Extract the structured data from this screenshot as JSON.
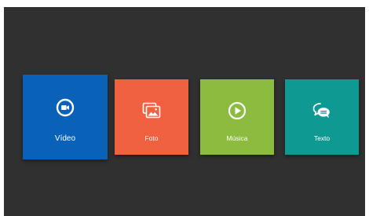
{
  "tiles": [
    {
      "id": "video",
      "label": "Vídeo",
      "icon": "video-camera-icon",
      "color": "#0a62b8",
      "focused": true
    },
    {
      "id": "foto",
      "label": "Foto",
      "icon": "photo-gallery-icon",
      "color": "#f0613f",
      "focused": false
    },
    {
      "id": "musica",
      "label": "Música",
      "icon": "play-icon",
      "color": "#8bbb3f",
      "focused": false
    },
    {
      "id": "texto",
      "label": "Texto",
      "icon": "chat-bubbles-icon",
      "color": "#0e9a92",
      "focused": false
    }
  ],
  "colors": {
    "background": "#303030",
    "icon_foreground": "#ffffff"
  }
}
